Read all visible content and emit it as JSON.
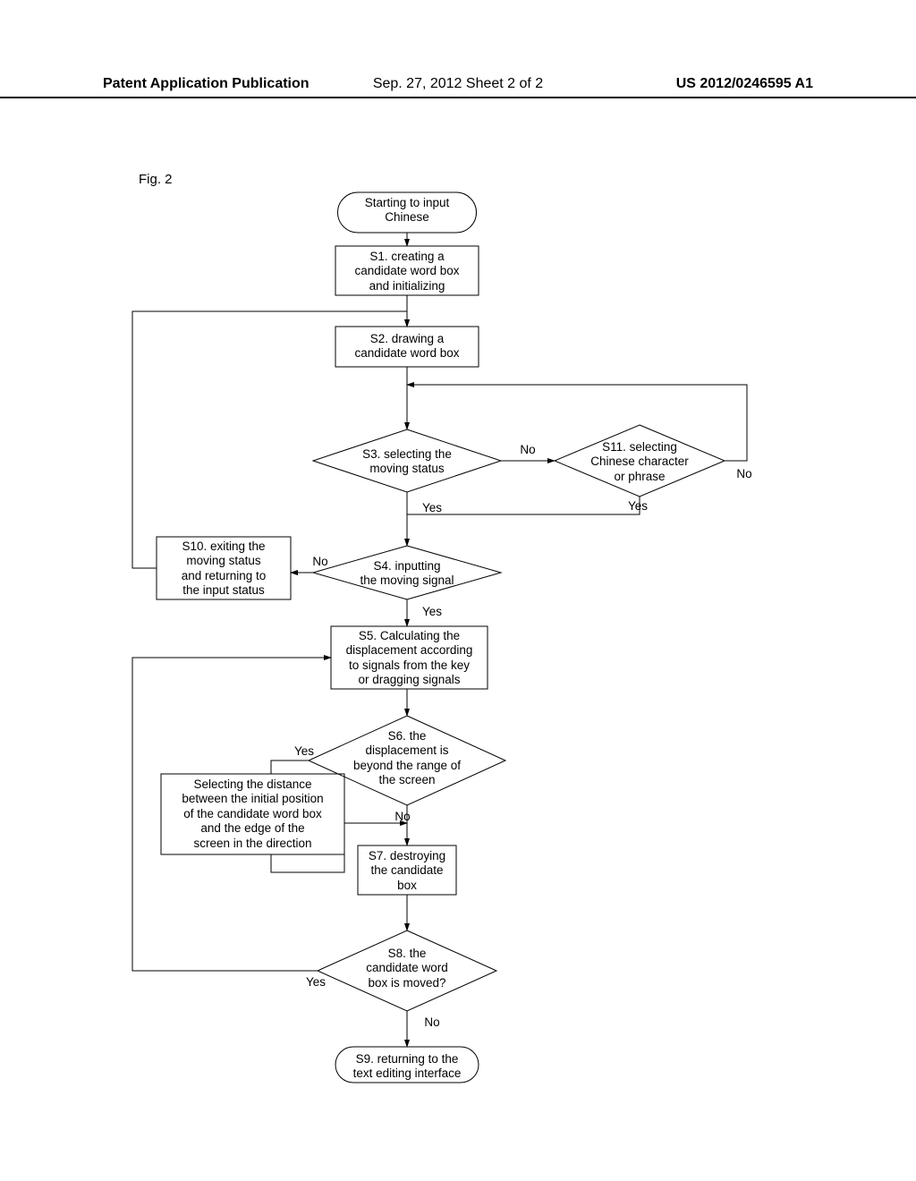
{
  "header": {
    "left": "Patent Application Publication",
    "mid": "Sep. 27, 2012  Sheet 2 of 2",
    "right": "US 2012/0246595 A1"
  },
  "figure_label": "Fig. 2",
  "nodes": {
    "start": "Starting to input\nChinese",
    "s1": "S1. creating a\ncandidate word box\nand initializing",
    "s2": "S2. drawing a\ncandidate word box",
    "s3": "S3. selecting the\nmoving status",
    "s11": "S11. selecting\nChinese character\nor phrase",
    "s4": "S4. inputting\nthe moving signal",
    "s10": "S10. exiting the\nmoving status\nand returning to\nthe input status",
    "s5": "S5. Calculating the\ndisplacement according\nto signals from the key\nor dragging signals",
    "s6": "S6. the\ndisplacement is\nbeyond the range of\nthe screen",
    "clip": "Selecting the distance\nbetween the initial position\nof the candidate word box\nand the edge of the\nscreen in the direction",
    "s7": "S7. destroying\nthe candidate\nbox",
    "s8": "S8. the\ncandidate word\nbox is moved?",
    "s9": "S9. returning to the\ntext editing interface"
  },
  "labels": {
    "yes": "Yes",
    "no": "No"
  }
}
